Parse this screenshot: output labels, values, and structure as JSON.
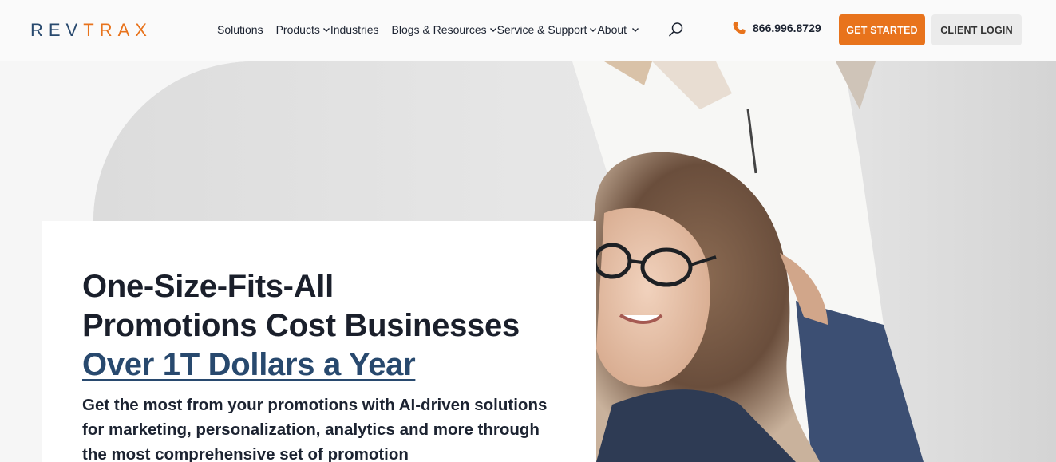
{
  "brand": {
    "logo_part1": "REV",
    "logo_part2": "TRAX",
    "accent_color": "#e8731c",
    "primary_color": "#28496e"
  },
  "nav": {
    "items": [
      {
        "label": "Solutions",
        "has_dropdown": false
      },
      {
        "label": "Products",
        "has_dropdown": true
      },
      {
        "label": "Industries",
        "has_dropdown": false
      },
      {
        "label": "Blogs & Resources",
        "has_dropdown": true
      },
      {
        "label": "Service & Support",
        "has_dropdown": true
      },
      {
        "label": "About",
        "has_dropdown": true
      }
    ],
    "search_icon": "search-icon",
    "phone": "866.996.8729",
    "phone_icon": "phone-icon",
    "cta_primary": "GET STARTED",
    "cta_secondary": "CLIENT LOGIN"
  },
  "hero": {
    "title_line1": "One-Size-Fits-All",
    "title_line2": "Promotions Cost Businesses",
    "title_highlight": "Over 1T Dollars a Year",
    "subtitle": "Get the most from your promotions with AI-driven solutions for marketing, personalization, analytics and more through the most comprehensive set of promotion"
  }
}
